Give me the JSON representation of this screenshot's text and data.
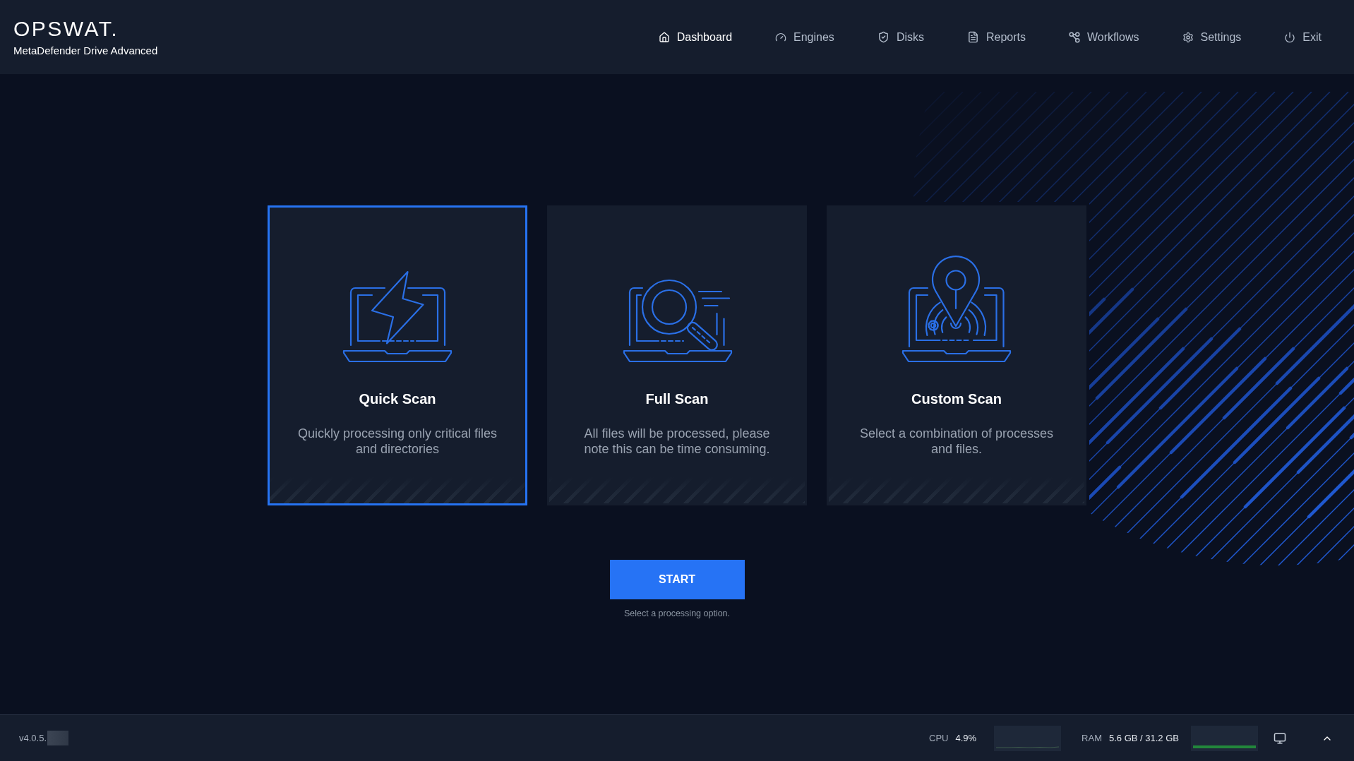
{
  "header": {
    "logo": "OPSWAT.",
    "product": "MetaDefender Drive Advanced"
  },
  "nav": [
    {
      "label": "Dashboard",
      "selected": true
    },
    {
      "label": "Engines",
      "selected": false
    },
    {
      "label": "Disks",
      "selected": false
    },
    {
      "label": "Reports",
      "selected": false
    },
    {
      "label": "Workflows",
      "selected": false
    },
    {
      "label": "Settings",
      "selected": false
    },
    {
      "label": "Exit",
      "selected": false
    }
  ],
  "scan_options": [
    {
      "title": "Quick Scan",
      "description": "Quickly processing only critical files and directories",
      "selected": true
    },
    {
      "title": "Full Scan",
      "description": "All files will be processed, please note this can be time consuming.",
      "selected": false
    },
    {
      "title": "Custom Scan",
      "description": "Select a combination of processes and files.",
      "selected": false
    }
  ],
  "start_button": {
    "label": "START"
  },
  "hint": "Select a processing option.",
  "status_bar": {
    "version": "v4.0.5.",
    "cpu": {
      "label": "CPU",
      "value": "4.9%"
    },
    "ram": {
      "label": "RAM",
      "value": "5.6 GB / 31.2 GB"
    }
  }
}
